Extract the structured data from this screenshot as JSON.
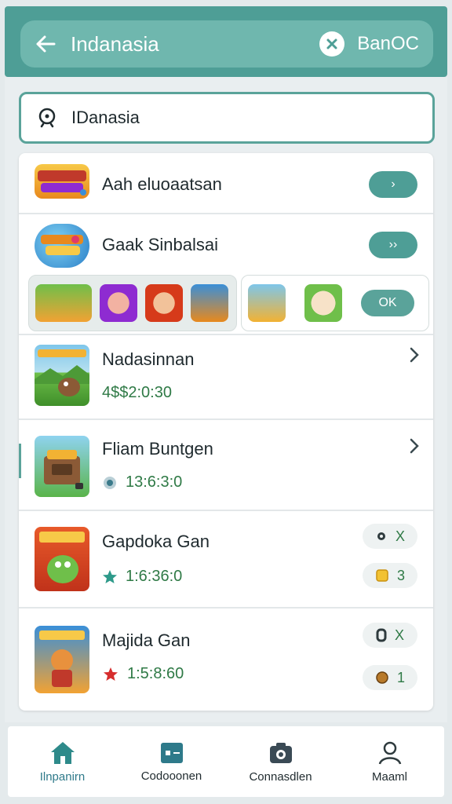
{
  "header": {
    "title": "Indanasia",
    "right_label": "BanOC",
    "back_icon": "arrow-left-icon",
    "right_icon": "close-circle-icon"
  },
  "search": {
    "value": "IDanasia",
    "icon": "search-icon"
  },
  "rows": [
    {
      "title": "Aah eluoaatsan",
      "button": "›"
    },
    {
      "title": "Gaak Sinbalsai",
      "button": "››"
    },
    {
      "title": "Nadasinnan",
      "meta": "4$$2:0:30"
    },
    {
      "title": "Fliam Buntgen",
      "meta": "13:6:3:0"
    },
    {
      "title": "Gapdoka Gan",
      "meta": "1:6:36:0",
      "badge1": "X",
      "badge2": "3"
    },
    {
      "title": "Majida Gan",
      "meta": "1:5:8:60",
      "badge1": "X",
      "badge2": "1"
    }
  ],
  "featured": {
    "ok_label": "OK"
  },
  "bottom_nav": [
    {
      "label": "Ilnpanirn",
      "icon": "home-icon"
    },
    {
      "label": "Codooonen",
      "icon": "id-card-icon"
    },
    {
      "label": "Connasdlen",
      "icon": "camera-icon"
    },
    {
      "label": "Maaml",
      "icon": "person-icon"
    }
  ],
  "colors": {
    "primary": "#4e9e96",
    "accent_green": "#2f7a46"
  }
}
